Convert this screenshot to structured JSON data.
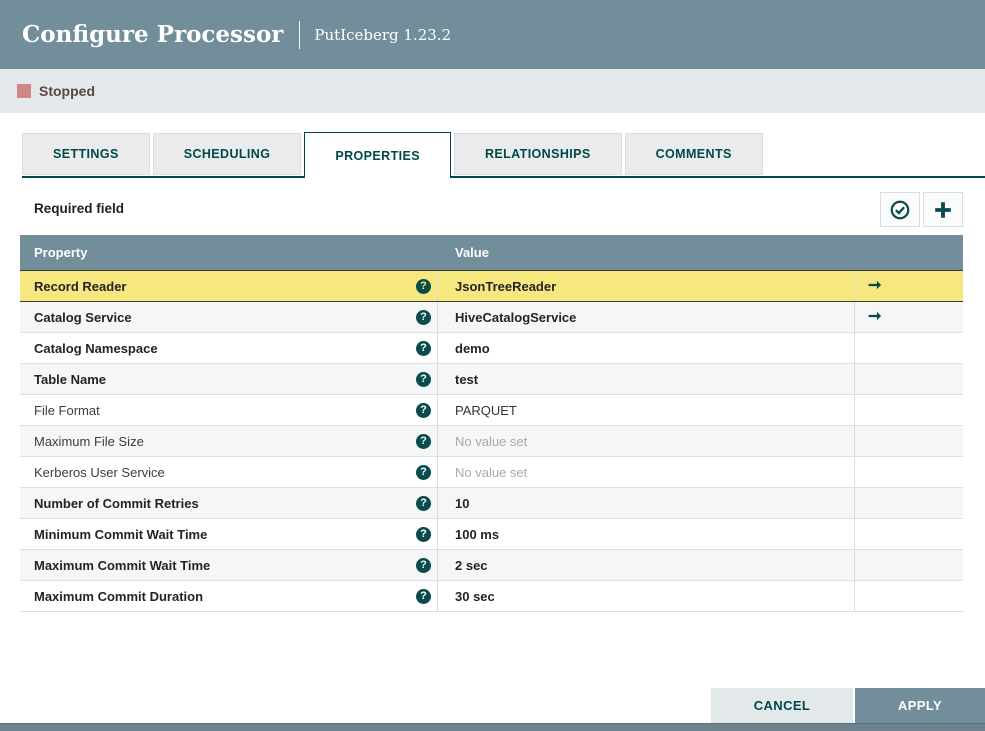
{
  "dialog": {
    "title": "Configure Processor",
    "subtitle": "PutIceberg 1.23.2",
    "status_label": "Stopped"
  },
  "tabs": [
    {
      "label": "SETTINGS",
      "active": false
    },
    {
      "label": "SCHEDULING",
      "active": false
    },
    {
      "label": "PROPERTIES",
      "active": true
    },
    {
      "label": "RELATIONSHIPS",
      "active": false
    },
    {
      "label": "COMMENTS",
      "active": false
    }
  ],
  "toolbar": {
    "required_label": "Required field",
    "icons": [
      "verify-properties-icon",
      "add-property-icon"
    ]
  },
  "table": {
    "columns": [
      "Property",
      "Value"
    ],
    "rows": [
      {
        "property": "Record Reader",
        "value": "JsonTreeReader",
        "required": true,
        "highlighted": true,
        "goto": true,
        "unset": false
      },
      {
        "property": "Catalog Service",
        "value": "HiveCatalogService",
        "required": true,
        "highlighted": false,
        "goto": true,
        "unset": false
      },
      {
        "property": "Catalog Namespace",
        "value": "demo",
        "required": true,
        "highlighted": false,
        "goto": false,
        "unset": false
      },
      {
        "property": "Table Name",
        "value": "test",
        "required": true,
        "highlighted": false,
        "goto": false,
        "unset": false
      },
      {
        "property": "File Format",
        "value": "PARQUET",
        "required": false,
        "highlighted": false,
        "goto": false,
        "unset": false
      },
      {
        "property": "Maximum File Size",
        "value": "No value set",
        "required": false,
        "highlighted": false,
        "goto": false,
        "unset": true
      },
      {
        "property": "Kerberos User Service",
        "value": "No value set",
        "required": false,
        "highlighted": false,
        "goto": false,
        "unset": true
      },
      {
        "property": "Number of Commit Retries",
        "value": "10",
        "required": true,
        "highlighted": false,
        "goto": false,
        "unset": false
      },
      {
        "property": "Minimum Commit Wait Time",
        "value": "100 ms",
        "required": true,
        "highlighted": false,
        "goto": false,
        "unset": false
      },
      {
        "property": "Maximum Commit Wait Time",
        "value": "2 sec",
        "required": true,
        "highlighted": false,
        "goto": false,
        "unset": false
      },
      {
        "property": "Maximum Commit Duration",
        "value": "30 sec",
        "required": true,
        "highlighted": false,
        "goto": false,
        "unset": false
      }
    ]
  },
  "footer": {
    "cancel_label": "CANCEL",
    "apply_label": "APPLY"
  },
  "colors": {
    "accent": "#004849",
    "titlebar": "#728E9B",
    "statusbar": "#E3E8EA",
    "stopped_square": "#D18686",
    "row_highlight": "#F7E77F",
    "row_alt": "#F4F6F7"
  }
}
